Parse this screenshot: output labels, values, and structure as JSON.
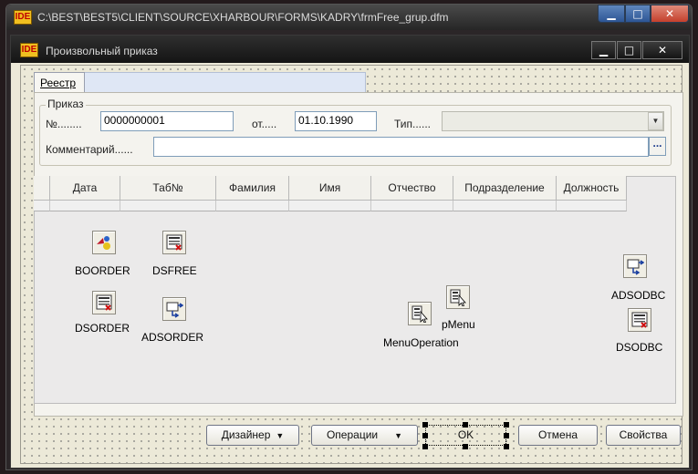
{
  "outer_window": {
    "title": "C:\\BEST\\BEST5\\CLIENT\\SOURCE\\XHARBOUR\\FORMS\\KADRY\\frmFree_grup.dfm",
    "logo": "IDE"
  },
  "inner_window": {
    "title": "Произвольный приказ",
    "logo": "IDE"
  },
  "tabs": [
    {
      "label": "Реестр",
      "active": true
    }
  ],
  "order_group": {
    "caption": "Приказ",
    "number_label": "№........",
    "number_value": "0000000001",
    "date_label": "от.....",
    "date_value": "01.10.1990",
    "type_label": "Тип......",
    "type_value": "",
    "comment_label": "Комментарий......",
    "comment_value": "",
    "ellipsis": "..."
  },
  "grid": {
    "columns": [
      "Дата",
      "Таб№",
      "Фамилия",
      "Имя",
      "Отчество",
      "Подразделение",
      "Должность"
    ]
  },
  "components": [
    {
      "name": "BOORDER",
      "icon": "boorder-icon"
    },
    {
      "name": "DSFREE",
      "icon": "dataset-icon"
    },
    {
      "name": "DSORDER",
      "icon": "dataset-icon"
    },
    {
      "name": "ADSORDER",
      "icon": "ads-icon"
    },
    {
      "name": "MenuOperation",
      "icon": "menu-icon"
    },
    {
      "name": "pMenu",
      "icon": "menu-icon"
    },
    {
      "name": "ADSODBC",
      "icon": "ads-icon"
    },
    {
      "name": "DSODBC",
      "icon": "dataset-icon"
    }
  ],
  "buttons": {
    "designer": "Дизайнер",
    "operations": "Операции",
    "ok": "OK",
    "cancel": "Отмена",
    "properties": "Свойства"
  },
  "colors": {
    "accent_window": "#1f3f8a",
    "close_red": "#c94a3b"
  }
}
